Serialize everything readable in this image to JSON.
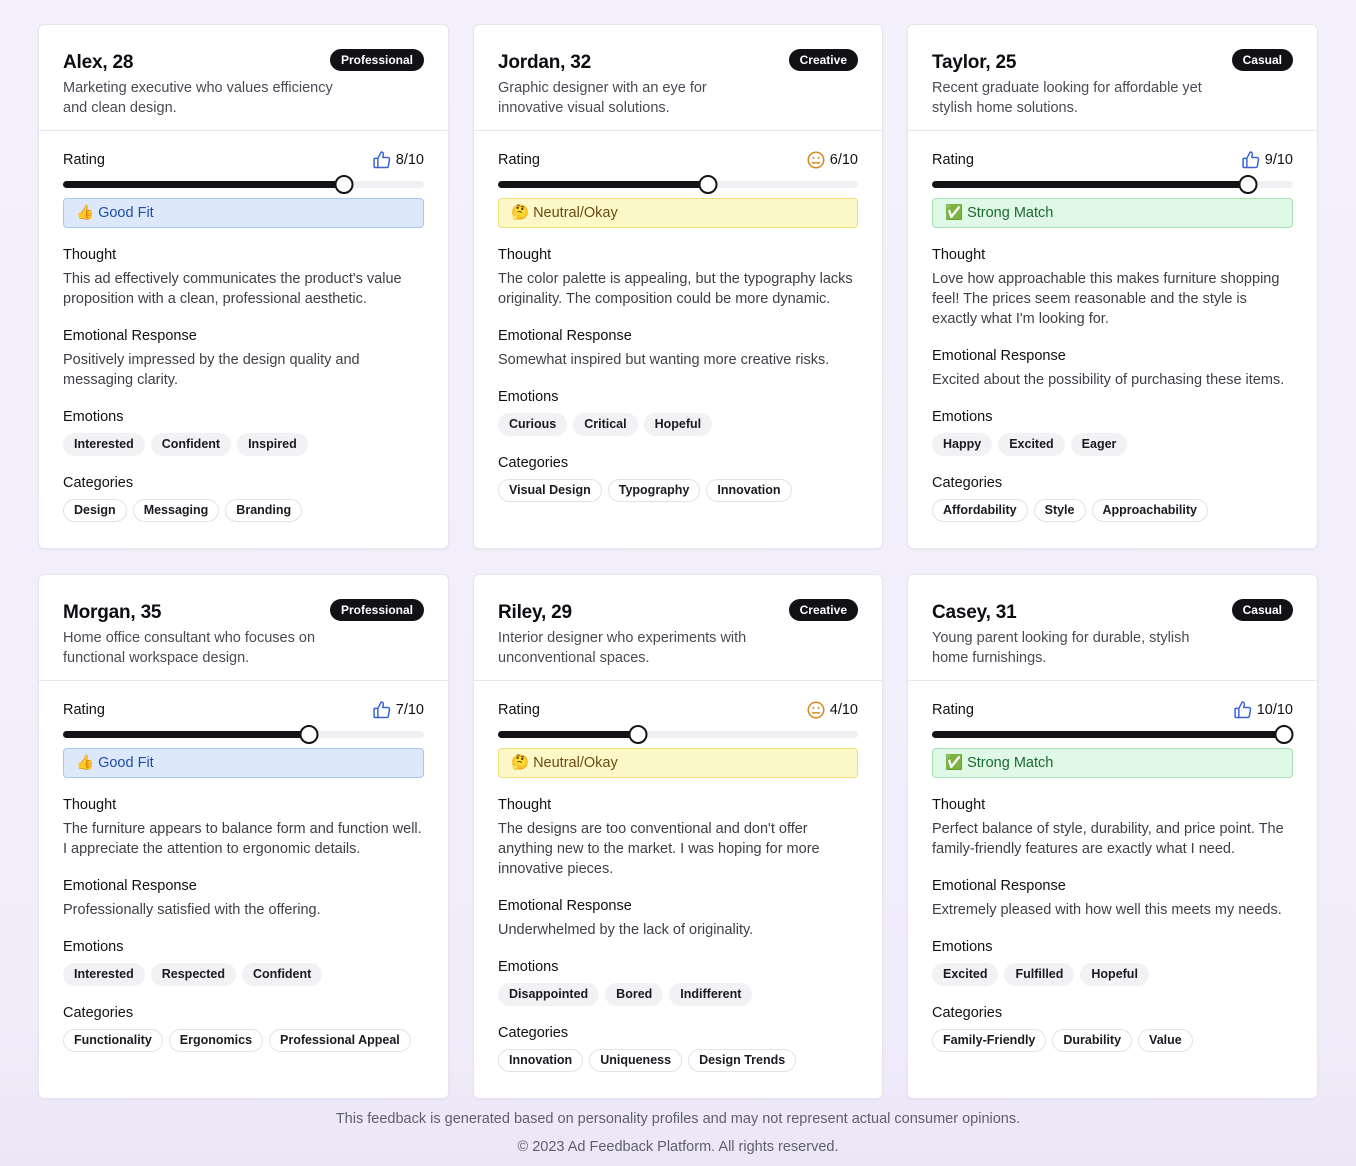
{
  "personas": [
    {
      "name": "Alex, 28",
      "badge": "Professional",
      "description": "Marketing executive who values efficiency and clean design.",
      "rating_label": "Rating",
      "icon": "thumbs-up-icon",
      "score": 8,
      "score_text": "8/10",
      "verdict_type": "good",
      "verdict": "👍 Good Fit",
      "thought_label": "Thought",
      "thought": "This ad effectively communicates the product's value proposition with a clean, professional aesthetic.",
      "emotional_label": "Emotional Response",
      "emotional_response": "Positively impressed by the design quality and messaging clarity.",
      "emotions_label": "Emotions",
      "emotions": [
        "Interested",
        "Confident",
        "Inspired"
      ],
      "categories_label": "Categories",
      "categories": [
        "Design",
        "Messaging",
        "Branding"
      ]
    },
    {
      "name": "Jordan, 32",
      "badge": "Creative",
      "description": "Graphic designer with an eye for innovative visual solutions.",
      "rating_label": "Rating",
      "icon": "neutral-face-icon",
      "score": 6,
      "score_text": "6/10",
      "verdict_type": "neutral",
      "verdict": "🤔 Neutral/Okay",
      "thought_label": "Thought",
      "thought": "The color palette is appealing, but the typography lacks originality. The composition could be more dynamic.",
      "emotional_label": "Emotional Response",
      "emotional_response": "Somewhat inspired but wanting more creative risks.",
      "emotions_label": "Emotions",
      "emotions": [
        "Curious",
        "Critical",
        "Hopeful"
      ],
      "categories_label": "Categories",
      "categories": [
        "Visual Design",
        "Typography",
        "Innovation"
      ]
    },
    {
      "name": "Taylor, 25",
      "badge": "Casual",
      "description": "Recent graduate looking for affordable yet stylish home solutions.",
      "rating_label": "Rating",
      "icon": "thumbs-up-icon",
      "score": 9,
      "score_text": "9/10",
      "verdict_type": "strong",
      "verdict": "✅ Strong Match",
      "thought_label": "Thought",
      "thought": "Love how approachable this makes furniture shopping feel! The prices seem reasonable and the style is exactly what I'm looking for.",
      "emotional_label": "Emotional Response",
      "emotional_response": "Excited about the possibility of purchasing these items.",
      "emotions_label": "Emotions",
      "emotions": [
        "Happy",
        "Excited",
        "Eager"
      ],
      "categories_label": "Categories",
      "categories": [
        "Affordability",
        "Style",
        "Approachability"
      ]
    },
    {
      "name": "Morgan, 35",
      "badge": "Professional",
      "description": "Home office consultant who focuses on functional workspace design.",
      "rating_label": "Rating",
      "icon": "thumbs-up-icon",
      "score": 7,
      "score_text": "7/10",
      "verdict_type": "good",
      "verdict": "👍 Good Fit",
      "thought_label": "Thought",
      "thought": "The furniture appears to balance form and function well. I appreciate the attention to ergonomic details.",
      "emotional_label": "Emotional Response",
      "emotional_response": "Professionally satisfied with the offering.",
      "emotions_label": "Emotions",
      "emotions": [
        "Interested",
        "Respected",
        "Confident"
      ],
      "categories_label": "Categories",
      "categories": [
        "Functionality",
        "Ergonomics",
        "Professional Appeal"
      ]
    },
    {
      "name": "Riley, 29",
      "badge": "Creative",
      "description": "Interior designer who experiments with unconventional spaces.",
      "rating_label": "Rating",
      "icon": "neutral-face-icon",
      "score": 4,
      "score_text": "4/10",
      "verdict_type": "neutral",
      "verdict": "🤔 Neutral/Okay",
      "thought_label": "Thought",
      "thought": "The designs are too conventional and don't offer anything new to the market. I was hoping for more innovative pieces.",
      "emotional_label": "Emotional Response",
      "emotional_response": "Underwhelmed by the lack of originality.",
      "emotions_label": "Emotions",
      "emotions": [
        "Disappointed",
        "Bored",
        "Indifferent"
      ],
      "categories_label": "Categories",
      "categories": [
        "Innovation",
        "Uniqueness",
        "Design Trends"
      ]
    },
    {
      "name": "Casey, 31",
      "badge": "Casual",
      "description": "Young parent looking for durable, stylish home furnishings.",
      "rating_label": "Rating",
      "icon": "thumbs-up-icon",
      "score": 10,
      "score_text": "10/10",
      "verdict_type": "strong",
      "verdict": "✅ Strong Match",
      "thought_label": "Thought",
      "thought": "Perfect balance of style, durability, and price point. The family-friendly features are exactly what I need.",
      "emotional_label": "Emotional Response",
      "emotional_response": "Extremely pleased with how well this meets my needs.",
      "emotions_label": "Emotions",
      "emotions": [
        "Excited",
        "Fulfilled",
        "Hopeful"
      ],
      "categories_label": "Categories",
      "categories": [
        "Family-Friendly",
        "Durability",
        "Value"
      ]
    }
  ],
  "footer": {
    "disclaimer": "This feedback is generated based on personality profiles and may not represent actual consumer opinions.",
    "copyright": "© 2023 Ad Feedback Platform. All rights reserved."
  }
}
